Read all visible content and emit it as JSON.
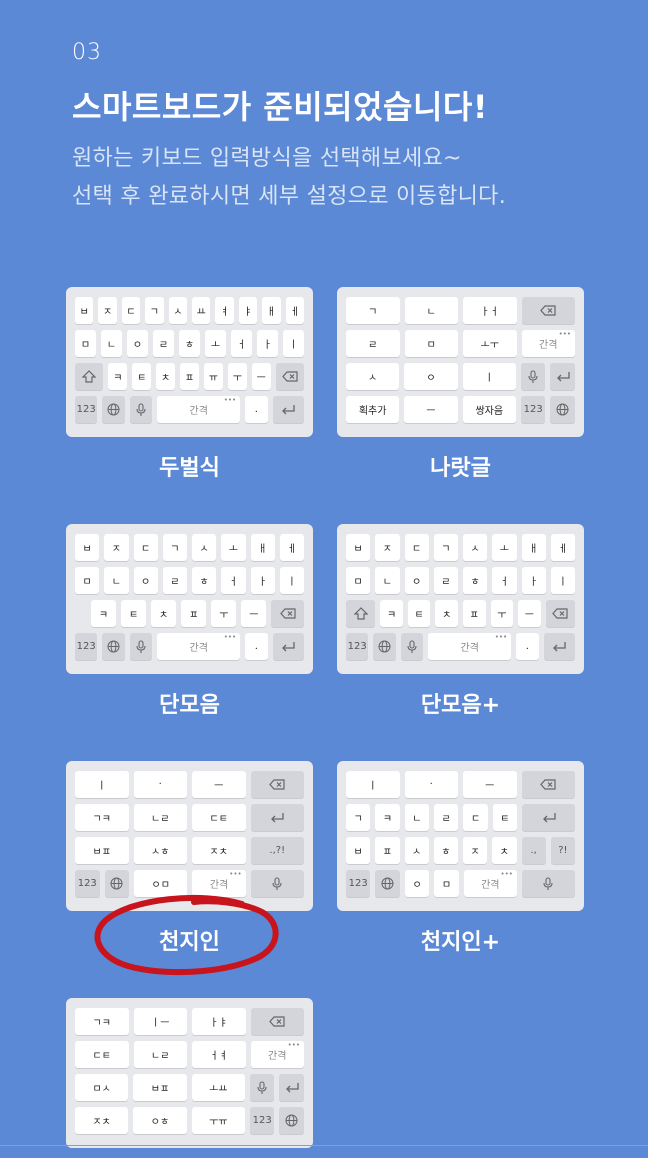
{
  "header": {
    "step": "03",
    "title": "스마트보드가 준비되었습니다!",
    "subtitle_line1": "원하는 키보드 입력방식을 선택해보세요~",
    "subtitle_line2": "선택 후 완료하시면 세부 설정으로 이동합니다."
  },
  "layouts": [
    {
      "name": "두벌식",
      "rows": [
        [
          "ㅂ",
          "ㅈ",
          "ㄷ",
          "ㄱ",
          "ㅅ",
          "ㅛ",
          "ㅕ",
          "ㅑ",
          "ㅐ",
          "ㅔ"
        ],
        [
          "ㅁ",
          "ㄴ",
          "ㅇ",
          "ㄹ",
          "ㅎ",
          "ㅗ",
          "ㅓ",
          "ㅏ",
          "ㅣ"
        ],
        [
          "shift-icon",
          "ㅋ",
          "ㅌ",
          "ㅊ",
          "ㅍ",
          "ㅠ",
          "ㅜ",
          "ㅡ",
          "backspace-icon"
        ],
        [
          "123",
          "globe-icon",
          "mic-icon",
          "간격",
          ".",
          "enter-icon"
        ]
      ]
    },
    {
      "name": "나랏글",
      "rows": [
        [
          "ㄱ",
          "ㄴ",
          "ㅏㅓ",
          "backspace-icon"
        ],
        [
          "ㄹ",
          "ㅁ",
          "ㅗㅜ",
          "간격"
        ],
        [
          "ㅅ",
          "ㅇ",
          "ㅣ",
          "mic-icon",
          "enter-icon"
        ],
        [
          "획추가",
          "ㅡ",
          "쌍자음",
          "123",
          "globe-icon"
        ]
      ]
    },
    {
      "name": "단모음",
      "rows": [
        [
          "ㅂ",
          "ㅈ",
          "ㄷ",
          "ㄱ",
          "ㅅ",
          "ㅗ",
          "ㅐ",
          "ㅔ"
        ],
        [
          "ㅁ",
          "ㄴ",
          "ㅇ",
          "ㄹ",
          "ㅎ",
          "ㅓ",
          "ㅏ",
          "ㅣ"
        ],
        [
          "ㅋ",
          "ㅌ",
          "ㅊ",
          "ㅍ",
          "ㅜ",
          "ㅡ",
          "backspace-icon"
        ],
        [
          "123",
          "globe-icon",
          "mic-icon",
          "간격",
          ".",
          "enter-icon"
        ]
      ]
    },
    {
      "name": "단모음+",
      "rows": [
        [
          "ㅂ",
          "ㅈ",
          "ㄷ",
          "ㄱ",
          "ㅅ",
          "ㅗ",
          "ㅐ",
          "ㅔ"
        ],
        [
          "ㅁ",
          "ㄴ",
          "ㅇ",
          "ㄹ",
          "ㅎ",
          "ㅓ",
          "ㅏ",
          "ㅣ"
        ],
        [
          "shift-icon",
          "ㅋ",
          "ㅌ",
          "ㅊ",
          "ㅍ",
          "ㅜ",
          "ㅡ",
          "backspace-icon"
        ],
        [
          "123",
          "globe-icon",
          "mic-icon",
          "간격",
          ".",
          "enter-icon"
        ]
      ]
    },
    {
      "name": "천지인",
      "selected": true,
      "rows": [
        [
          "ㅣ",
          "·",
          "ㅡ",
          "backspace-icon"
        ],
        [
          "ㄱㅋ",
          "ㄴㄹ",
          "ㄷㅌ",
          "enter-icon"
        ],
        [
          "ㅂㅍ",
          "ㅅㅎ",
          "ㅈㅊ",
          ".,?!"
        ],
        [
          "123",
          "globe-icon",
          "ㅇㅁ",
          "간격",
          "mic-icon"
        ]
      ]
    },
    {
      "name": "천지인+",
      "rows": [
        [
          "ㅣ",
          "·",
          "ㅡ",
          "backspace-icon"
        ],
        [
          "ㄱ",
          "ㅋ",
          "ㄴ",
          "ㄹ",
          "ㄷ",
          "ㅌ",
          "enter-icon"
        ],
        [
          "ㅂ",
          "ㅍ",
          "ㅅ",
          "ㅎ",
          "ㅈ",
          "ㅊ",
          ".,",
          "?!"
        ],
        [
          "123",
          "globe-icon",
          "ㅇ",
          "ㅁ",
          "간격",
          "mic-icon"
        ]
      ]
    },
    {
      "name": "",
      "rows": [
        [
          "ㄱㅋ",
          "ㅣㅡ",
          "ㅏㅑ",
          "backspace-icon"
        ],
        [
          "ㄷㅌ",
          "ㄴㄹ",
          "ㅓㅕ",
          "간격"
        ],
        [
          "ㅁㅅ",
          "ㅂㅍ",
          "ㅗㅛ",
          "mic-icon",
          "enter-icon"
        ],
        [
          "ㅈㅊ",
          "ㅇㅎ",
          "ㅜㅠ",
          "123",
          "globe-icon"
        ]
      ]
    }
  ],
  "selection_color": "#c8141c"
}
